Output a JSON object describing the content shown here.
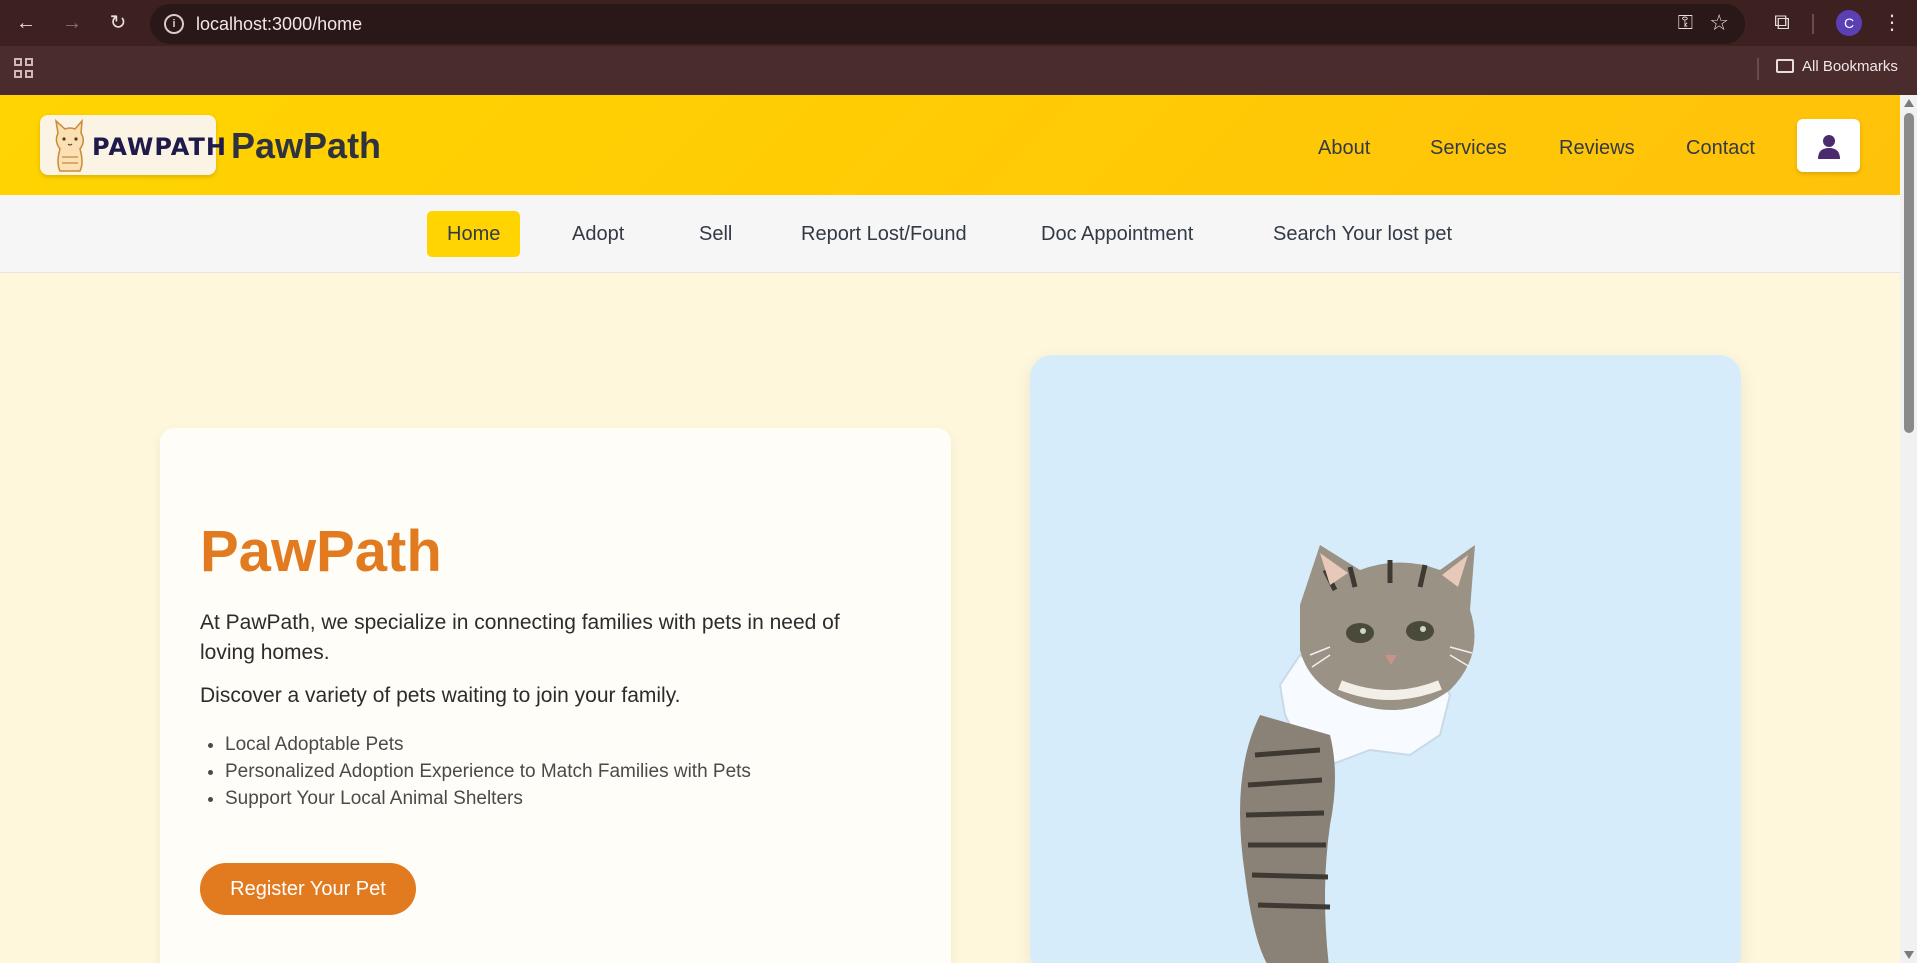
{
  "browser": {
    "url": "localhost:3000/home",
    "profile_initial": "C",
    "bookmarks_label": "All Bookmarks"
  },
  "header": {
    "logo_text": "PAWPATH",
    "brand": "PawPath",
    "nav": [
      "About",
      "Services",
      "Reviews",
      "Contact"
    ]
  },
  "subnav": {
    "items": [
      "Home",
      "Adopt",
      "Sell",
      "Report Lost/Found",
      "Doc Appointment",
      "Search Your lost pet"
    ],
    "active": "Home"
  },
  "hero": {
    "title": "PawPath",
    "paragraph1": "At PawPath, we specialize in connecting families with pets in need of loving homes.",
    "paragraph2": "Discover a variety of pets waiting to join your family.",
    "features": [
      "Local Adoptable Pets",
      "Personalized Adoption Experience to Match Families with Pets",
      "Support Your Local Animal Shelters"
    ],
    "button": "Register Your Pet"
  },
  "colors": {
    "header": "#ffd400",
    "accent": "#e27b1f",
    "image_bg": "#d7ecfb"
  }
}
